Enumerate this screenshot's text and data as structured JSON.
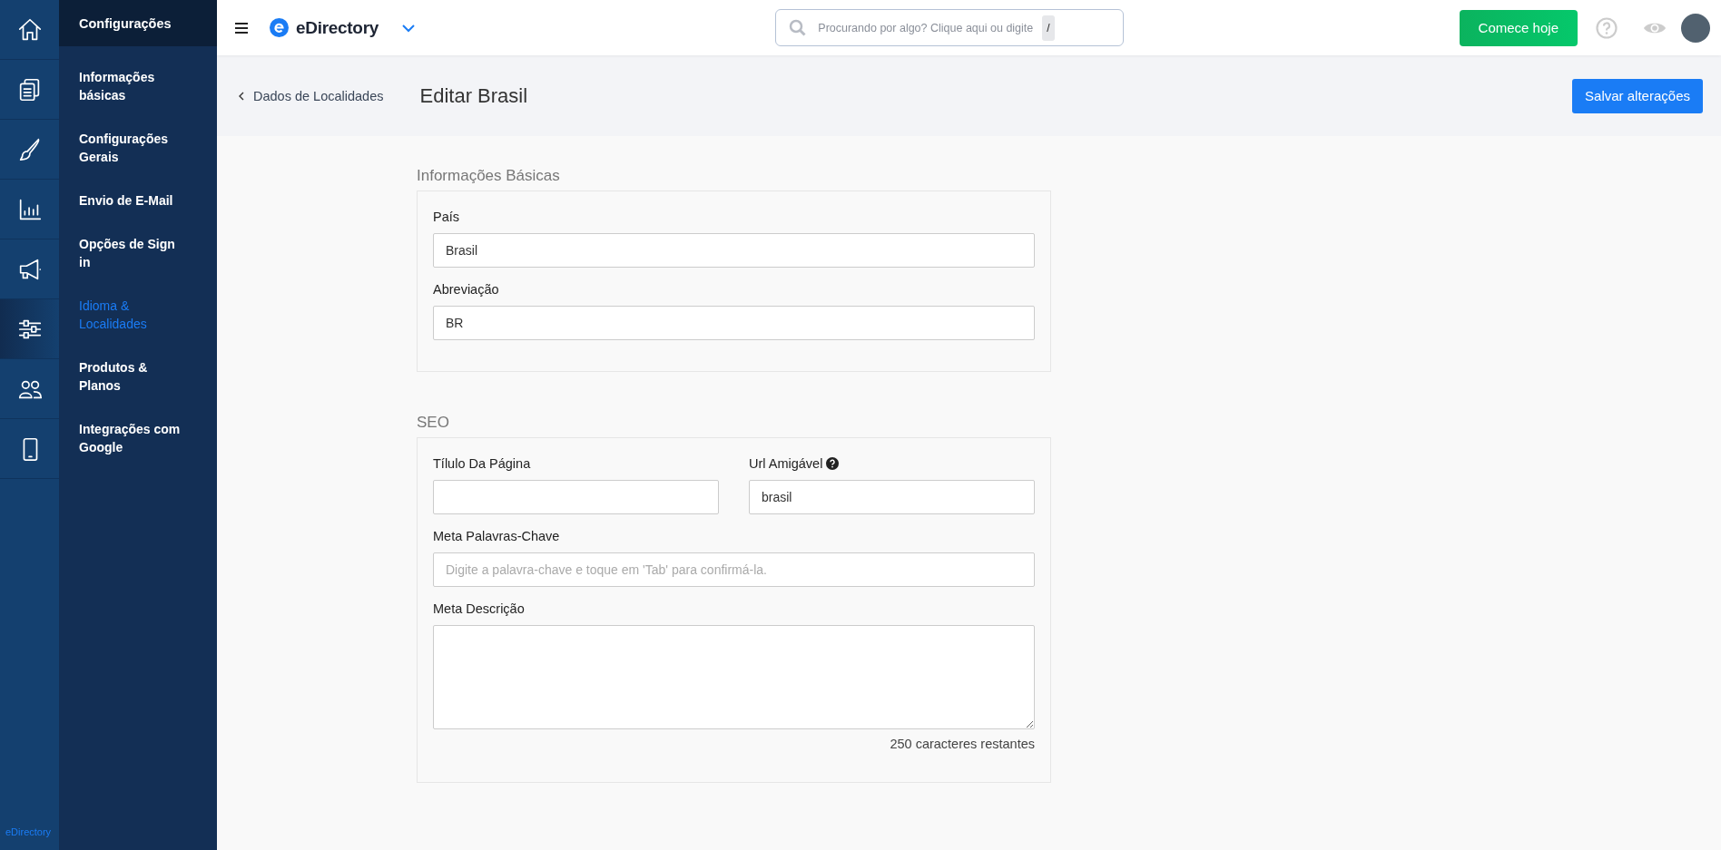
{
  "rail": {
    "items": [
      {
        "kind": "home",
        "selected": false
      },
      {
        "kind": "pages",
        "selected": false
      },
      {
        "kind": "brush",
        "selected": false
      },
      {
        "kind": "chart",
        "selected": false
      },
      {
        "kind": "megaphone",
        "selected": false
      },
      {
        "kind": "sliders",
        "selected": true
      },
      {
        "kind": "users",
        "selected": false
      },
      {
        "kind": "mobile",
        "selected": false
      }
    ],
    "footer": "eDirectory"
  },
  "sidebar": {
    "title": "Configurações",
    "items": [
      {
        "label": "Informações básicas",
        "selected": false
      },
      {
        "label": "Configurações Gerais",
        "selected": false
      },
      {
        "label": "Envio de E-Mail",
        "selected": false
      },
      {
        "label": "Opções de Sign in",
        "selected": false
      },
      {
        "label": "Idioma & Localidades",
        "selected": true
      },
      {
        "label": "Produtos & Planos",
        "selected": false
      },
      {
        "label": "Integrações com Google",
        "selected": false
      }
    ]
  },
  "topbar": {
    "brand": "eDirectory",
    "search": {
      "placeholder": "Procurando por algo? Clique aqui ou digite",
      "shortcut": "/"
    },
    "cta": "Comece hoje"
  },
  "header": {
    "back": "Dados de Localidades",
    "title": "Editar Brasil",
    "save": "Salvar alterações"
  },
  "sections": [
    {
      "title": "Informações Básicas",
      "rows": [
        [
          {
            "label": "País",
            "kind": "text",
            "value": "Brasil"
          }
        ],
        [
          {
            "label": "Abreviação",
            "kind": "text",
            "value": "BR"
          }
        ]
      ]
    },
    {
      "title": "SEO",
      "rows": [
        [
          {
            "label": "Tílulo Da Página",
            "kind": "text"
          },
          {
            "label": "Url Amigável",
            "kind": "text",
            "value": "brasil",
            "help": true
          }
        ],
        [
          {
            "label": "Meta Palavras-Chave",
            "kind": "text",
            "placeholder": "Digite a palavra-chave e toque em 'Tab' para confirmá-la."
          }
        ],
        [
          {
            "label": "Meta Descrição",
            "kind": "textarea",
            "counter": "250 caracteres restantes"
          }
        ]
      ]
    }
  ]
}
